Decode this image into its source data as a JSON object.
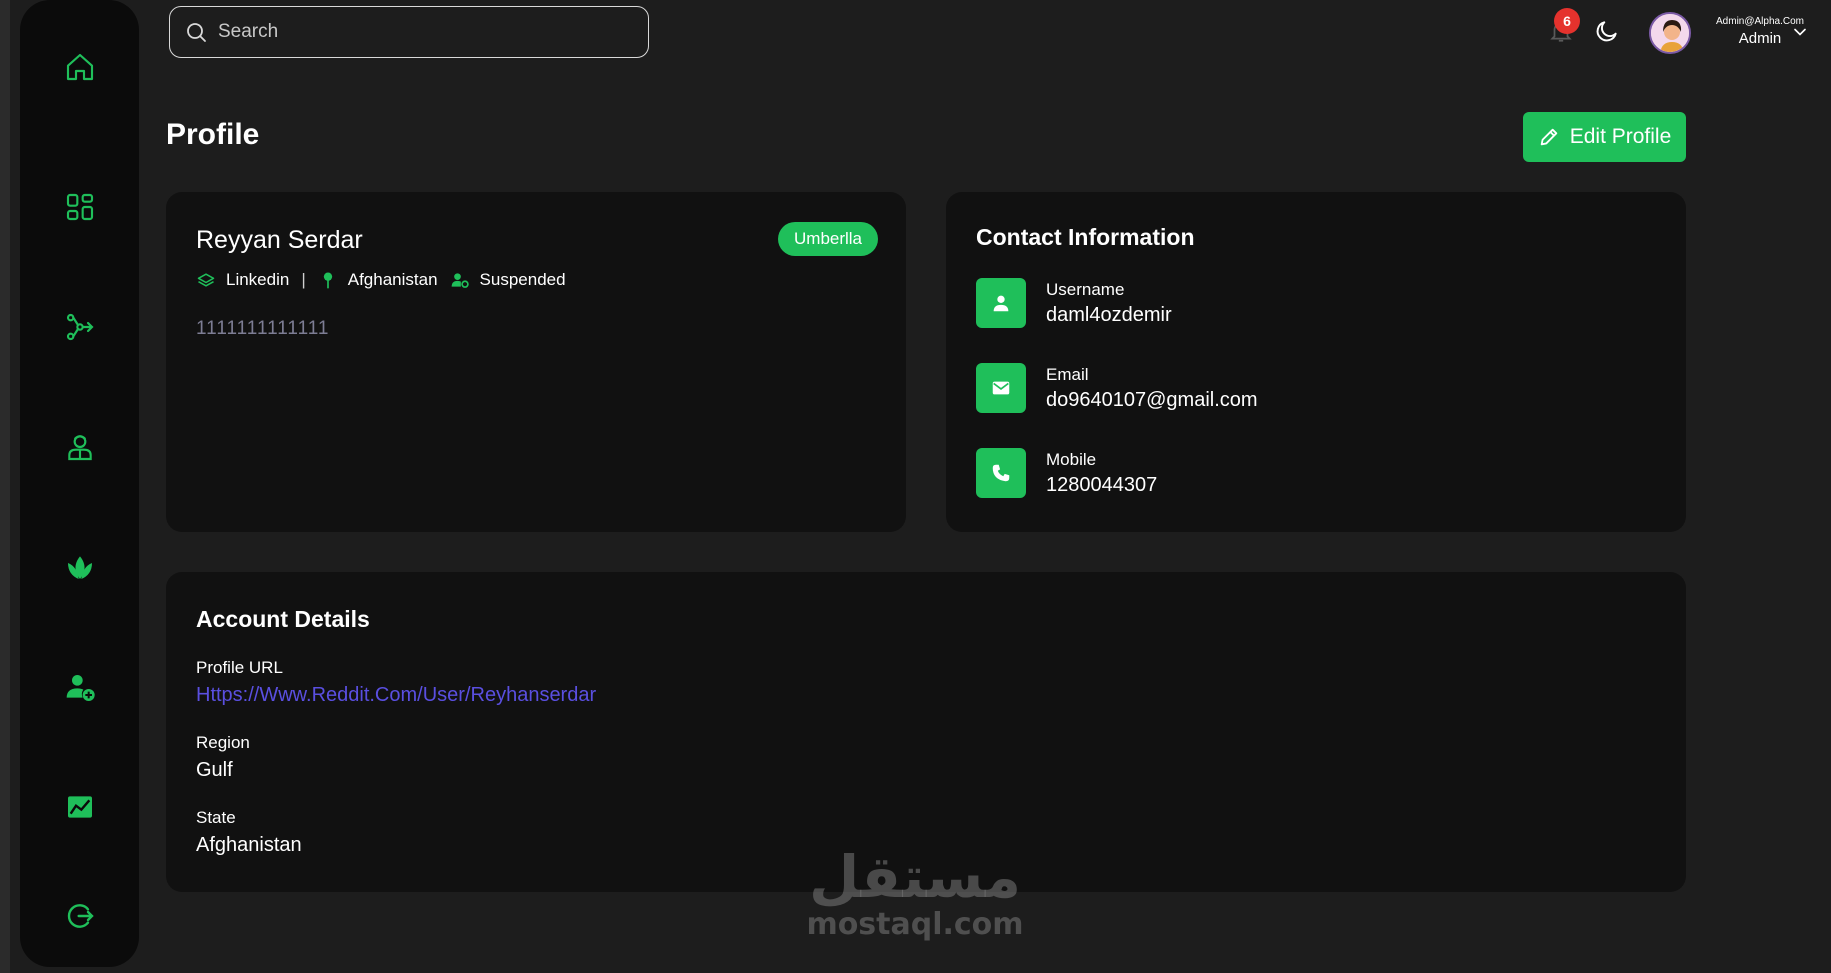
{
  "colors": {
    "accent": "#1fbf5a",
    "background": "#1d1d1d",
    "card": "#111111",
    "sidebar": "#0b0b0b",
    "link": "#5a4fe0",
    "badge": "#e5322d"
  },
  "sidebar": {
    "items": [
      {
        "icon": "home-icon"
      },
      {
        "icon": "dashboard-grid-icon"
      },
      {
        "icon": "share-branch-icon"
      },
      {
        "icon": "user-agent-icon"
      },
      {
        "icon": "plant-icon"
      },
      {
        "icon": "add-user-icon"
      },
      {
        "icon": "chart-icon"
      },
      {
        "icon": "logout-icon"
      }
    ]
  },
  "header": {
    "search_placeholder": "Search",
    "notifications_count": "6",
    "user": {
      "email": "Admin@Alpha.Com",
      "role": "Admin"
    }
  },
  "page": {
    "title": "Profile",
    "edit_button": "Edit Profile"
  },
  "profile": {
    "name": "Reyyan Serdar",
    "tag": "Umberlla",
    "source": "Linkedin",
    "separator": "|",
    "country": "Afghanistan",
    "status": "Suspended",
    "bio": "1111111111111"
  },
  "contact": {
    "title": "Contact Information",
    "items": [
      {
        "label": "Username",
        "value": "daml4ozdemir",
        "icon": "user-icon"
      },
      {
        "label": "Email",
        "value": "do9640107@gmail.com",
        "icon": "mail-icon"
      },
      {
        "label": "Mobile",
        "value": "1280044307",
        "icon": "phone-icon"
      }
    ]
  },
  "account": {
    "title": "Account Details",
    "profile_url_label": "Profile URL",
    "profile_url": "Https://Www.Reddit.Com/User/Reyhanserdar",
    "region_label": "Region",
    "region": "Gulf",
    "state_label": "State",
    "state": "Afghanistan"
  },
  "watermark": {
    "arabic": "مستقل",
    "latin": "mostaql.com"
  }
}
